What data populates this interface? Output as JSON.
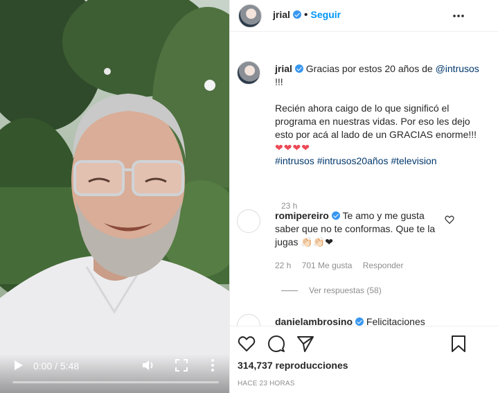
{
  "video": {
    "time": "0:00 / 5:48",
    "progress": 0.0,
    "icons": [
      "play-icon",
      "volume-icon",
      "fullscreen-icon",
      "more-vertical-icon"
    ]
  },
  "header": {
    "username": "jrial",
    "separator": "•",
    "follow_label": "Seguir",
    "icons": [
      "verified-badge-icon",
      "more-horizontal-icon"
    ]
  },
  "caption": {
    "username": "jrial",
    "text_start": "Gracias por estos 20 años de",
    "mention": "@intrusos",
    "text_after_mention": " !!!",
    "paragraph2": "Recién ahora caigo de lo que significó el programa en nuestras vidas. Por eso les dejo esto por acá al lado de un GRACIAS enorme!!!",
    "hearts": "❤❤❤❤",
    "hashtags": [
      "#intrusos",
      "#intrusos20años",
      "#television"
    ],
    "time": "23 h"
  },
  "comments": [
    {
      "username": "romipereiro",
      "text": "Te amo y me gusta saber que no te conformas. Que te la jugas",
      "emoji": "👏🏻👏🏻❤",
      "time": "22 h",
      "likes": "701 Me gusta",
      "reply_label": "Responder",
      "view_replies": "Ver respuestas (58)"
    },
    {
      "username": "danielambrosino",
      "text": "Felicitaciones"
    }
  ],
  "actions": {
    "views_count": "314,737",
    "views_label": "reproducciones",
    "posted": "HACE 23 HORAS",
    "icons": [
      "heart-icon",
      "comment-icon",
      "share-icon",
      "bookmark-icon"
    ]
  },
  "colors": {
    "accent": "#0095f6",
    "link": "#00376b",
    "muted": "#8e8e8e",
    "heart": "#ed4956",
    "verified": "#3897f0"
  }
}
